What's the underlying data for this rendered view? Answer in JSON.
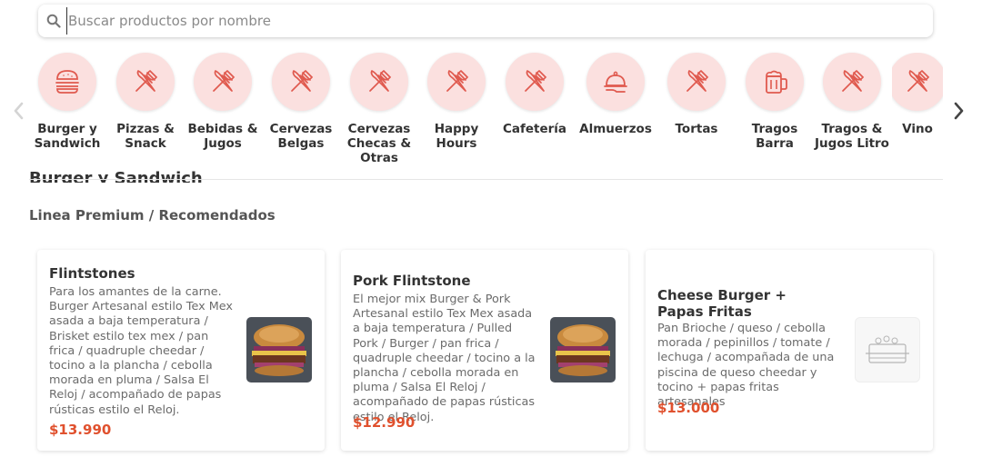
{
  "search": {
    "placeholder": "Buscar productos por nombre"
  },
  "categories": [
    {
      "label": "Burger y Sandwich",
      "icon": "burger-icon"
    },
    {
      "label": "Pizzas & Snack",
      "icon": "utensils-icon"
    },
    {
      "label": "Bebidas & Jugos",
      "icon": "utensils-icon"
    },
    {
      "label": "Cervezas Belgas",
      "icon": "utensils-icon"
    },
    {
      "label": "Cervezas Checas & Otras",
      "icon": "utensils-icon"
    },
    {
      "label": "Happy Hours",
      "icon": "utensils-icon"
    },
    {
      "label": "Cafetería",
      "icon": "utensils-icon"
    },
    {
      "label": "Almuerzos",
      "icon": "serving-dish-icon"
    },
    {
      "label": "Tortas",
      "icon": "utensils-icon"
    },
    {
      "label": "Tragos Barra",
      "icon": "beer-mug-icon"
    },
    {
      "label": "Tragos & Jugos Litro",
      "icon": "utensils-icon"
    },
    {
      "label": "Vino",
      "icon": "utensils-icon"
    }
  ],
  "section": {
    "title": "Burger y Sandwich",
    "subtitle": "Linea Premium / Recomendados"
  },
  "products": [
    {
      "name": "Flintstones",
      "description": "Para los amantes de la carne. Burger Artesanal estilo Tex Mex asada a baja temperatura / Brisket estilo tex mex / pan frica / quadruple cheedar / tocino a la plancha / cebolla morada en pluma / Salsa El Reloj / acompañado de papas rústicas estilo el Reloj.",
      "price": "$13.990"
    },
    {
      "name": "Pork Flintstone",
      "description": "El mejor mix Burger & Pork Artesanal estilo Tex Mex asada a baja temperatura / Pulled Pork / Burger / pan frica / quadruple cheedar / tocino a la plancha / cebolla morada en pluma / Salsa El Reloj / acompañado de papas rústicas estilo el Reloj.",
      "price": "$12.990"
    },
    {
      "name": "Cheese Burger + Papas Fritas",
      "description": "Pan Brioche / queso / cebolla morada / pepinillos / tomate / lechuga / acompañada de una piscina de queso cheedar y tocino + papas fritas artesanales",
      "price": "$13.000"
    }
  ],
  "colors": {
    "accent": "#e0512e",
    "category_bg": "#fbe0df",
    "icon_stroke": "#e05a4f"
  }
}
